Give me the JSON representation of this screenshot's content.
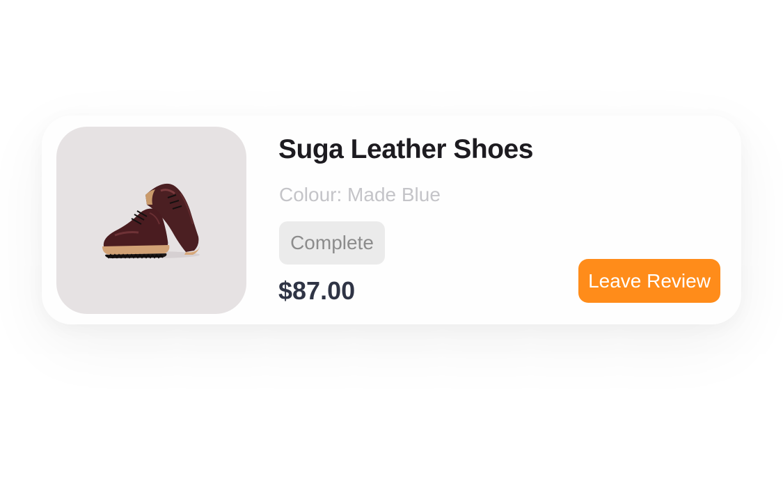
{
  "product": {
    "image_alt": "leather-shoes-image",
    "title": "Suga Leather Shoes",
    "colour_text": "Colour: Made Blue",
    "status": "Complete",
    "price": "$87.00",
    "action_label": "Leave Review"
  },
  "colors": {
    "accent": "#ff8c1a",
    "title": "#1d1b20",
    "muted": "#c4c4c8",
    "price": "#2f3445",
    "status_bg": "#ebebeb",
    "status_text": "#8c8c8c",
    "thumb_bg": "#e6e2e3"
  }
}
